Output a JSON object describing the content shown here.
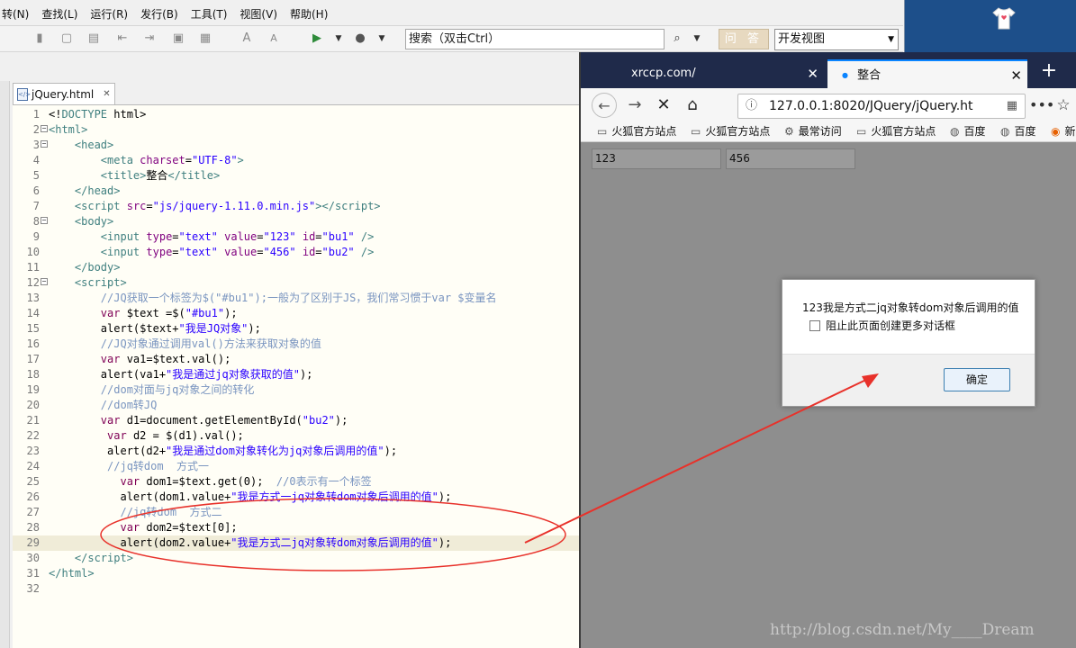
{
  "ide": {
    "menu": [
      "转(N)",
      "查找(L)",
      "运行(R)",
      "发行(B)",
      "工具(T)",
      "视图(V)",
      "帮助(H)"
    ],
    "search_placeholder": "搜索（双击Ctrl）",
    "ask_label": "问 答",
    "view_select": "开发视图",
    "file_tab": "jQuery.html",
    "file_icon_text": "</>",
    "code_lines": [
      {
        "n": "1",
        "fold": "",
        "html": "<span class='tx'>&lt;!</span><span class='tg'>DOCTYPE</span><span class='tx'> html&gt;</span>"
      },
      {
        "n": "2",
        "fold": "−",
        "html": "<span class='tg'>&lt;html&gt;</span>"
      },
      {
        "n": "3",
        "fold": "−",
        "html": "    <span class='tg'>&lt;head&gt;</span>"
      },
      {
        "n": "4",
        "fold": "",
        "html": "        <span class='tg'>&lt;meta</span> <span class='at'>charset</span>=<span class='av'>\"UTF-8\"</span><span class='tg'>&gt;</span>"
      },
      {
        "n": "5",
        "fold": "",
        "html": "        <span class='tg'>&lt;title&gt;</span>整合<span class='tg'>&lt;/title&gt;</span>"
      },
      {
        "n": "6",
        "fold": "",
        "html": "    <span class='tg'>&lt;/head&gt;</span>"
      },
      {
        "n": "7",
        "fold": "",
        "html": "    <span class='tg'>&lt;script</span> <span class='at'>src</span>=<span class='av'>\"js/jquery-1.11.0.min.js\"</span><span class='tg'>&gt;&lt;/script&gt;</span>"
      },
      {
        "n": "8",
        "fold": "−",
        "html": "    <span class='tg'>&lt;body&gt;</span>"
      },
      {
        "n": "9",
        "fold": "",
        "html": "        <span class='tg'>&lt;input</span> <span class='at'>type</span>=<span class='av'>\"text\"</span> <span class='at'>value</span>=<span class='av'>\"123\"</span> <span class='at'>id</span>=<span class='av'>\"bu1\"</span> <span class='tg'>/&gt;</span>"
      },
      {
        "n": "10",
        "fold": "",
        "html": "        <span class='tg'>&lt;input</span> <span class='at'>type</span>=<span class='av'>\"text\"</span> <span class='at'>value</span>=<span class='av'>\"456\"</span> <span class='at'>id</span>=<span class='av'>\"bu2\"</span> <span class='tg'>/&gt;</span>"
      },
      {
        "n": "11",
        "fold": "",
        "html": "    <span class='tg'>&lt;/body&gt;</span>"
      },
      {
        "n": "12",
        "fold": "−",
        "html": "    <span class='tg'>&lt;script&gt;</span>"
      },
      {
        "n": "13",
        "fold": "",
        "html": "        <span class='cm'>//JQ获取一个标签为$(\"#bu1\");一般为了区别于JS，我们常习惯于var $变量名</span>"
      },
      {
        "n": "14",
        "fold": "",
        "html": "        <span class='kw'>var</span> $text =$(<span class='st'>\"#bu1\"</span>);"
      },
      {
        "n": "15",
        "fold": "",
        "html": "        alert($text+<span class='st'>\"我是JQ对象\"</span>);"
      },
      {
        "n": "16",
        "fold": "",
        "html": "        <span class='cm'>//JQ对象通过调用val()方法来获取对象的值</span>"
      },
      {
        "n": "17",
        "fold": "",
        "html": "        <span class='kw'>var</span> va1=$text.val();"
      },
      {
        "n": "18",
        "fold": "",
        "html": "        alert(va1+<span class='st'>\"我是通过jq对象获取的值\"</span>);"
      },
      {
        "n": "19",
        "fold": "",
        "html": "        <span class='cm'>//dom对面与jq对象之间的转化</span>"
      },
      {
        "n": "20",
        "fold": "",
        "html": "        <span class='cm'>//dom转JQ</span>"
      },
      {
        "n": "21",
        "fold": "",
        "html": "        <span class='kw'>var</span> d1=document.getElementById(<span class='st'>\"bu2\"</span>);"
      },
      {
        "n": "22",
        "fold": "",
        "html": "         <span class='kw'>var</span> d2 = $(d1).val();"
      },
      {
        "n": "23",
        "fold": "",
        "html": "         alert(d2+<span class='st'>\"我是通过dom对象转化为jq对象后调用的值\"</span>);"
      },
      {
        "n": "24",
        "fold": "",
        "html": "         <span class='cm'>//jq转dom  方式一</span>"
      },
      {
        "n": "25",
        "fold": "",
        "html": "           <span class='kw'>var</span> dom1=$text.get(0);  <span class='cm'>//0表示有一个标签</span>"
      },
      {
        "n": "26",
        "fold": "",
        "html": "           alert(dom1.value+<span class='st'>\"我是方式一jq对象转dom对象后调用的值\"</span>);"
      },
      {
        "n": "27",
        "fold": "",
        "html": "           <span class='cm'>//jq转dom  方式二</span>"
      },
      {
        "n": "28",
        "fold": "",
        "html": "           <span class='kw'>var</span> dom2=$text[0];"
      },
      {
        "n": "29",
        "fold": "",
        "html": "           alert(dom2.value+<span class='st'>\"我是方式二jq对象转dom对象后调用的值\"</span>);"
      },
      {
        "n": "30",
        "fold": "",
        "html": "    <span class='tg'>&lt;/script&gt;</span>"
      },
      {
        "n": "31",
        "fold": "",
        "html": "<span class='tg'>&lt;/html&gt;</span>"
      },
      {
        "n": "32",
        "fold": "",
        "html": ""
      }
    ]
  },
  "firefox": {
    "tabs": [
      {
        "label": "xrccp.com/",
        "active": false
      },
      {
        "label": "整合",
        "active": true
      }
    ],
    "new_tab": "+",
    "url": "127.0.0.1:8020/JQuery/jQuery.ht",
    "bookmarks": [
      "火狐官方站点",
      "火狐官方站点",
      "最常访问",
      "火狐官方站点",
      "百度",
      "百度",
      "新"
    ],
    "page_inputs": [
      "123",
      "456"
    ],
    "dialog": {
      "message": "123我是方式二jq对象转dom对象后调用的值",
      "checkbox_label": "阻止此页面创建更多对话框",
      "ok_label": "确定"
    },
    "watermark": "http://blog.csdn.net/My____Dream"
  },
  "colors": {
    "annotation_red": "#e8312a",
    "firefox_tabbar": "#1f2a4a",
    "desktop": "#1d4f8a"
  }
}
